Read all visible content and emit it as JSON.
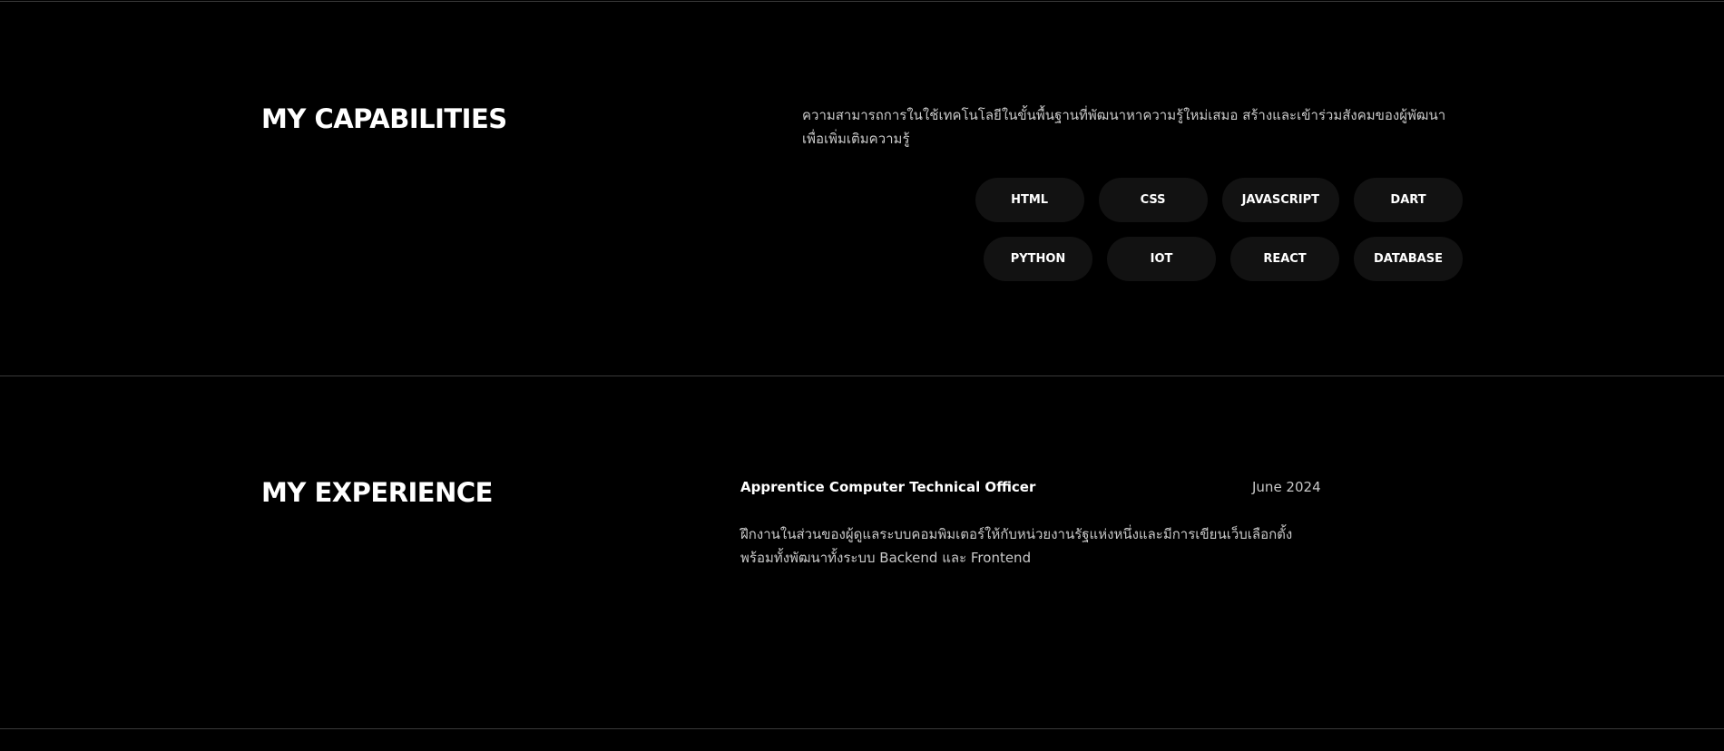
{
  "capabilities": {
    "title": "MY CAPABILITIES",
    "description": "ความสามารถการในใช้เทคโนโลยีในขั้นพื้นฐานที่พัฒนาหาความรู้ใหม่เสมอ สร้างและเข้าร่วมสังคมของผู้พัฒนาเพื่อเพิ่มเติมความรู้",
    "skills": [
      {
        "label": "HTML"
      },
      {
        "label": "CSS"
      },
      {
        "label": "JAVASCRIPT"
      },
      {
        "label": "DART"
      },
      {
        "label": "PYTHON"
      },
      {
        "label": "IOT"
      },
      {
        "label": "REACT"
      },
      {
        "label": "DATABASE"
      }
    ]
  },
  "experience": {
    "title": "MY EXPERIENCE",
    "items": [
      {
        "role": "Apprentice Computer Technical Officer",
        "date": "June 2024",
        "description": "ฝึกงานในส่วนของผู้ดูแลระบบคอมพิมเตอร์ให้กับหน่วยงานรัฐแห่งหนึ่งและมีการเขียนเว็บเลือกตั้ง พร้อมทั้งพัฒนาทั้งระบบ Backend และ Frontend"
      }
    ]
  },
  "colors": {
    "background": "#000000",
    "pill_background": "#121212",
    "heading": "#ffffff",
    "body_text": "#c8c8c8",
    "divider": "#3a3a3a"
  }
}
